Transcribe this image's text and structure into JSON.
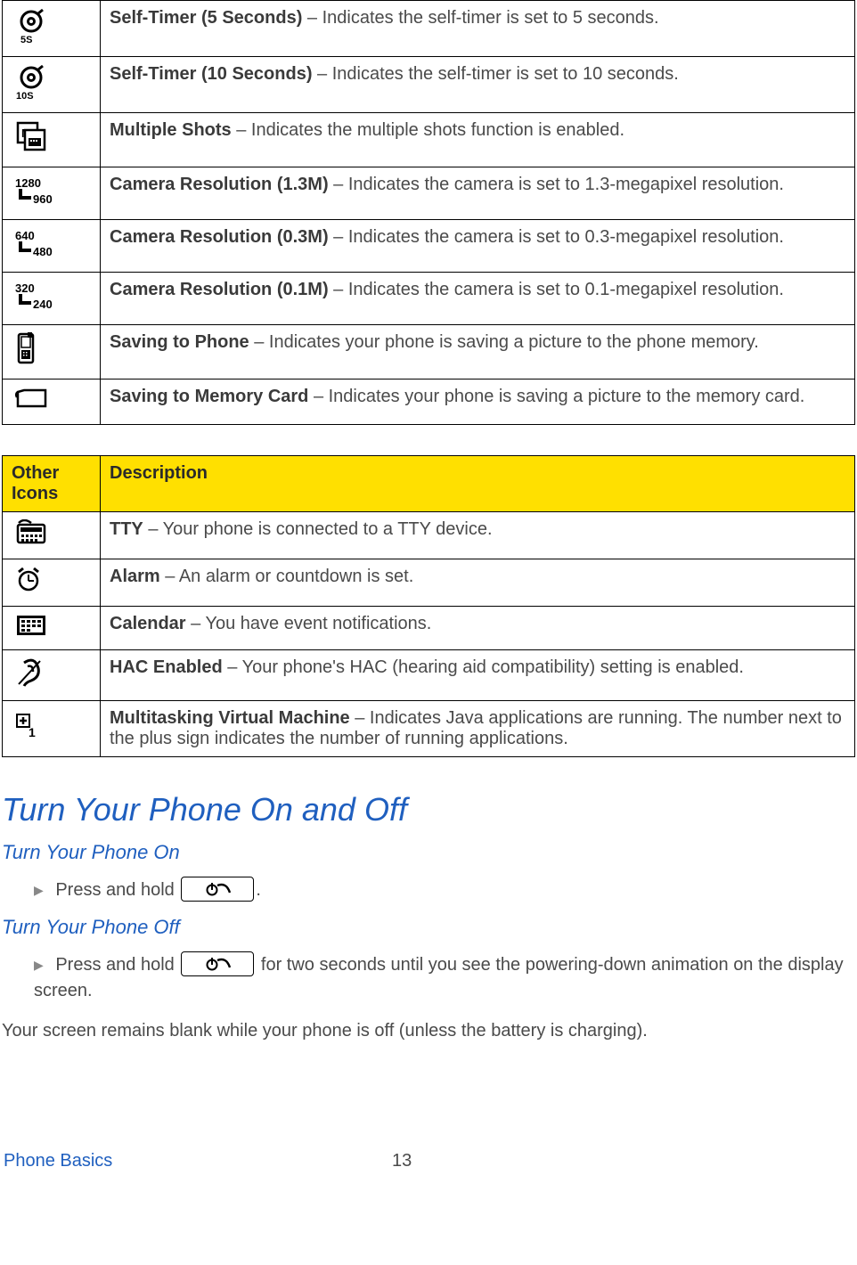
{
  "table1": {
    "rows": [
      {
        "icon": "timer5-icon",
        "term": "Self-Timer (5 Seconds)",
        "desc": " – Indicates the self-timer is set to 5 seconds."
      },
      {
        "icon": "timer10-icon",
        "term": "Self-Timer (10 Seconds)",
        "desc": " – Indicates the self-timer is set to 10 seconds."
      },
      {
        "icon": "multishot-icon",
        "term": "Multiple Shots",
        "desc": " – Indicates the multiple shots function is enabled."
      },
      {
        "icon": "res13-icon",
        "term": "Camera Resolution (1.3M)",
        "desc": " – Indicates the camera is set to 1.3-megapixel resolution."
      },
      {
        "icon": "res03-icon",
        "term": "Camera Resolution (0.3M)",
        "desc": " – Indicates the camera is set to 0.3-megapixel resolution."
      },
      {
        "icon": "res01-icon",
        "term": "Camera Resolution (0.1M)",
        "desc": " – Indicates the camera is set to 0.1-megapixel resolution."
      },
      {
        "icon": "save-phone-icon",
        "term": "Saving to Phone",
        "desc": " – Indicates your phone is saving a picture to the phone memory."
      },
      {
        "icon": "save-card-icon",
        "term": "Saving to Memory Card",
        "desc": " – Indicates your phone is saving a picture to the memory card."
      }
    ]
  },
  "table2": {
    "header_left": "Other Icons",
    "header_right": "Description",
    "rows": [
      {
        "icon": "tty-icon",
        "term": "TTY",
        "desc": " – Your phone is connected to a TTY device."
      },
      {
        "icon": "alarm-icon",
        "term": "Alarm",
        "desc": " – An alarm or countdown is set."
      },
      {
        "icon": "calendar-icon",
        "term": "Calendar",
        "desc": " – You have event notifications."
      },
      {
        "icon": "hac-icon",
        "term": "HAC Enabled",
        "desc": " – Your phone's HAC (hearing aid compatibility) setting is enabled."
      },
      {
        "icon": "mvm-icon",
        "term": "Multitasking Virtual Machine",
        "desc": " – Indicates Java applications are running. The number next to the plus sign indicates the number of running applications."
      }
    ]
  },
  "section": {
    "title": "Turn Your Phone On and Off",
    "sub1": "Turn Your Phone On",
    "step1_prefix": "Press and hold ",
    "step1_suffix": ".",
    "sub2": "Turn Your Phone Off",
    "step2_prefix": "Press and hold ",
    "step2_suffix": " for two seconds until you see the powering-down animation on the display screen.",
    "note": "Your screen remains blank while your phone is off (unless the battery is charging)."
  },
  "footer": {
    "section": "Phone Basics",
    "page": "13"
  }
}
